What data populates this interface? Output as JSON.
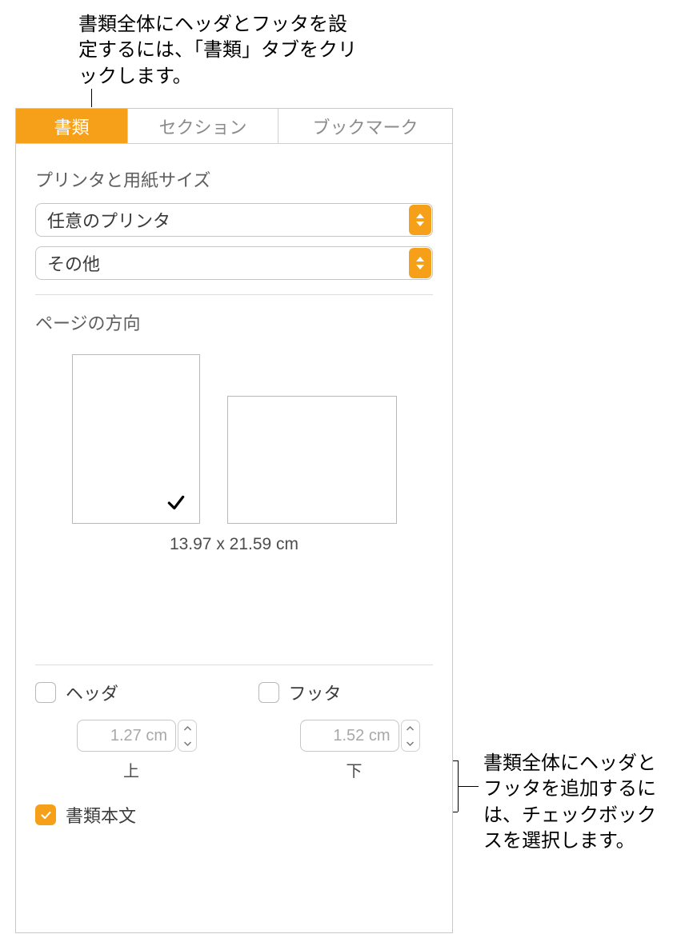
{
  "callouts": {
    "top": "書類全体にヘッダとフッタを設定するには、「書類」タブをクリックします。",
    "right": "書類全体にヘッダとフッタを追加するには、チェックボックスを選択します。"
  },
  "tabs": {
    "document": "書類",
    "section": "セクション",
    "bookmarks": "ブックマーク"
  },
  "printer": {
    "section_title": "プリンタと用紙サイズ",
    "printer_selected": "任意のプリンタ",
    "paper_selected": "その他"
  },
  "orientation": {
    "section_title": "ページの方向",
    "dimensions": "13.97 x 21.59 cm"
  },
  "header_footer": {
    "header_label": "ヘッダ",
    "footer_label": "フッタ",
    "header_margin": "1.27 cm",
    "footer_margin": "1.52 cm",
    "top_label": "上",
    "bottom_label": "下",
    "document_body_label": "書類本文"
  }
}
